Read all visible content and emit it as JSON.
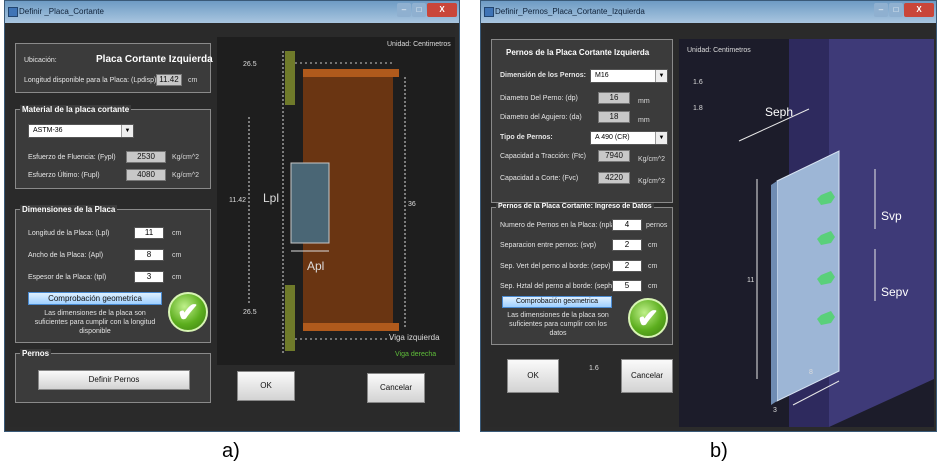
{
  "win_a": {
    "title": "Definir _Placa_Cortante",
    "controls": {
      "min": "–",
      "max": "□",
      "close": "X"
    },
    "ubicacion": {
      "label": "Ubicación:",
      "value": "Placa Cortante  Izquierda",
      "longitud_label": "Longitud disponible para la Placa: (Lpdisp)",
      "longitud_value": "11.42",
      "longitud_unit": "cm"
    },
    "material": {
      "title": "Material de la placa cortante",
      "selected": "ASTM-36",
      "fluencia_label": "Esfuerzo de Fluencia: (Fypl)",
      "fluencia_value": "2530",
      "fluencia_unit": "Kg/cm^2",
      "ultimo_label": "Esfuerzo Último: (Fupl)",
      "ultimo_value": "4080",
      "ultimo_unit": "Kg/cm^2"
    },
    "dimensiones": {
      "title": "Dimensiones de la Placa",
      "longitud_label": "Longitud de la Placa: (Lpl)",
      "longitud_value": "11",
      "ancho_label": "Ancho de la Placa: (Apl)",
      "ancho_value": "8",
      "espesor_label": "Espesor de la Placa: (tpl)",
      "espesor_value": "3",
      "unit": "cm",
      "check_button": "Comprobación geometrica",
      "note": "Las dimensiones de la placa son suficientes para cumplir con la longitud disponible"
    },
    "pernos": {
      "title": "Pernos",
      "button": "Definir Pernos"
    },
    "drawing": {
      "unidad": "Unidad: Centimetros",
      "top_dim": "26.5",
      "bottom_dim": "26.5",
      "left_dim": "11.42",
      "right_dim": "36",
      "lpl": "Lpl",
      "apl": "Apl",
      "viga_izq": "Viga izquierda",
      "viga_der": "Viga derecha"
    },
    "ok": "OK",
    "cancel": "Cancelar",
    "check_icon": "✔"
  },
  "win_b": {
    "title": "Definir_Pernos_Placa_Cortante_Izquierda",
    "controls": {
      "min": "–",
      "max": "□",
      "close": "X"
    },
    "pernos": {
      "heading": "Pernos de la Placa Cortante Izquierda",
      "dim_label": "Dimensión de los Pernos:",
      "dim_selected": "M16",
      "dp_label": "Diametro Del Perno: (dp)",
      "dp_value": "16",
      "dp_unit": "mm",
      "da_label": "Diametro del Agujero: (da)",
      "da_value": "18",
      "da_unit": "mm",
      "tipo_label": "Tipo de Pernos:",
      "tipo_selected": "A 490 (CR)",
      "ftc_label": "Capacidad a Tracción: (Ftc)",
      "ftc_value": "7940",
      "ftc_unit": "Kg/cm^2",
      "fvc_label": "Capacidad a Corte: (Fvc)",
      "fvc_value": "4220",
      "fvc_unit": "Kg/cm^2"
    },
    "ingreso": {
      "title": "Pernos de la Placa Cortante:   Ingreso de Datos",
      "n_label": "Numero de Pernos en la Placa: (nplaca)",
      "n_value": "4",
      "n_unit": "pernos",
      "svp_label": "Separacion entre pernos: (svp)",
      "svp_value": "2",
      "sepv_label": "Sep. Vert del perno al borde: (sepv)",
      "sepv_value": "2",
      "seph_label": "Sep. Hztal del perno al borde: (seph)",
      "seph_value": "5",
      "unit": "cm",
      "check_button": "Comprobación geometrica",
      "note": "Las dimensiones de la placa son suficientes para cumplir con los datos"
    },
    "ok": "OK",
    "mid_value": "1.6",
    "cancel": "Cancelar",
    "check_icon": "✔",
    "drawing": {
      "unidad": "Unidad: Centimetros",
      "v1": "1.6",
      "v2": "1.8",
      "seph": "Seph",
      "svp": "Svp",
      "sepv": "Sepv",
      "len": "11",
      "width": "8",
      "thick": "3"
    }
  },
  "captions": {
    "a": "a)",
    "b": "b)"
  }
}
